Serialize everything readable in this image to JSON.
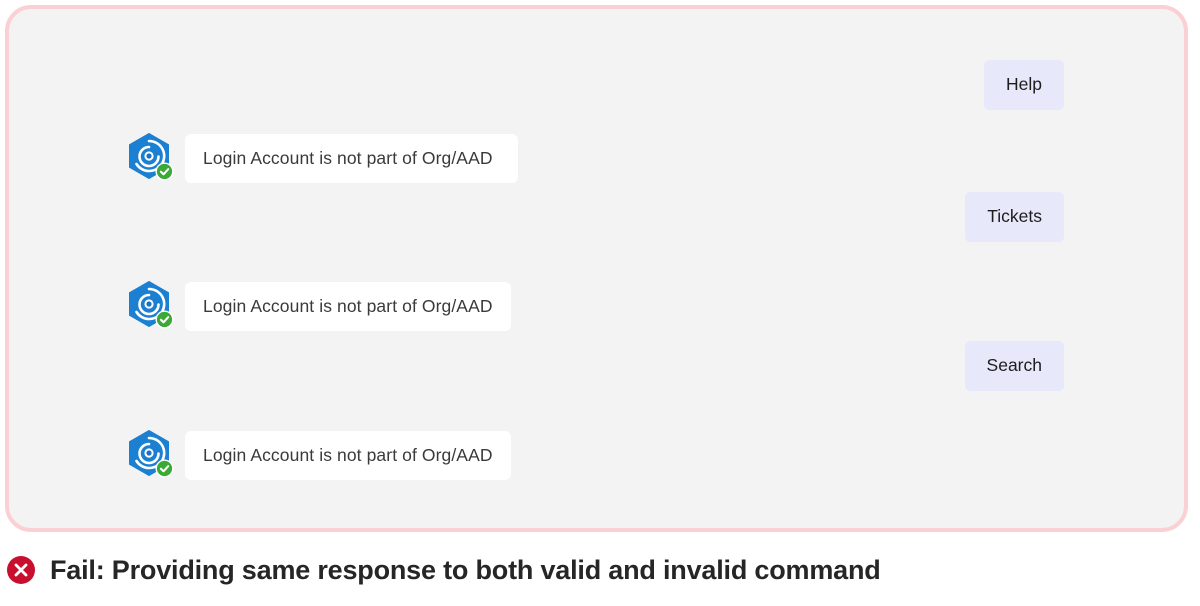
{
  "chat": {
    "messages": [
      {
        "avatar_icon": "bot-hexagon-avatar-icon",
        "status_icon": "verified-check-badge-icon",
        "text": "Login Account is not part of Org/AAD"
      },
      {
        "avatar_icon": "bot-hexagon-avatar-icon",
        "status_icon": "verified-check-badge-icon",
        "text": "Login Account is not part of Org/AAD"
      },
      {
        "avatar_icon": "bot-hexagon-avatar-icon",
        "status_icon": "verified-check-badge-icon",
        "text": "Login Account is not part of Org/AAD"
      }
    ],
    "suggestions": [
      {
        "label": "Help"
      },
      {
        "label": "Tickets"
      },
      {
        "label": "Search"
      }
    ]
  },
  "caption": {
    "icon": "error-circle-x-icon",
    "text": "Fail: Providing same response to both valid and invalid command"
  },
  "colors": {
    "panel_border": "#fbd0d5",
    "panel_background": "#f3f3f3",
    "bubble_background": "#ffffff",
    "chip_background": "#e7e9fa",
    "avatar_blue": "#1b81d4",
    "avatar_blue_dark": "#2f6fbe",
    "badge_green": "#3ba935",
    "error_red": "#c8102e",
    "caption_text": "#262626",
    "bubble_text": "#3a3a3a"
  }
}
